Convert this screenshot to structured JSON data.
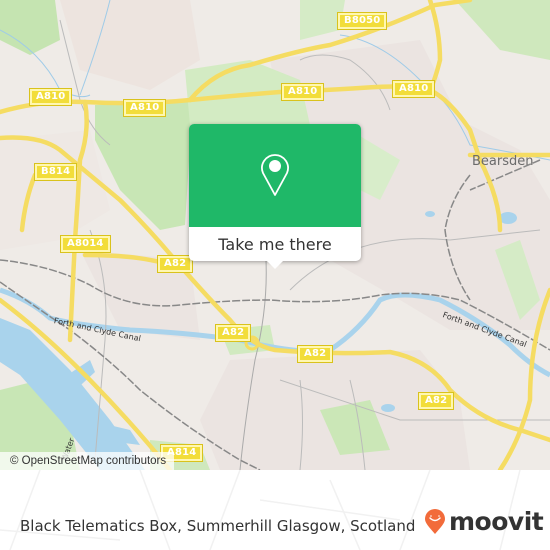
{
  "map": {
    "popup": {
      "button_label": "Take me there",
      "icon": "map-pin-icon",
      "color": "#1fb868"
    },
    "road_shields": [
      {
        "label": "A810",
        "id": "a810-west"
      },
      {
        "label": "A810",
        "id": "a810-central"
      },
      {
        "label": "A810",
        "id": "a810-north"
      },
      {
        "label": "A810",
        "id": "a810-east"
      },
      {
        "label": "B8050",
        "id": "b8050"
      },
      {
        "label": "B814",
        "id": "b814"
      },
      {
        "label": "A8014",
        "id": "a8014"
      },
      {
        "label": "A82",
        "id": "a82-north"
      },
      {
        "label": "A82",
        "id": "a82-junction"
      },
      {
        "label": "A82",
        "id": "a82-central"
      },
      {
        "label": "A82",
        "id": "a82-east"
      },
      {
        "label": "A814",
        "id": "a814"
      }
    ],
    "places": [
      {
        "label": "Bearsden"
      }
    ],
    "waterway_labels": [
      {
        "label": "Forth and Clyde Canal"
      },
      {
        "label": "Forth and Clyde Canal"
      }
    ],
    "river_label": "Water",
    "attribution": "© OpenStreetMap contributors"
  },
  "footer": {
    "location_text": "Black Telematics Box, Summerhill Glasgow, Scotland",
    "brand": "moovit",
    "brand_color": "#f26b3a"
  }
}
